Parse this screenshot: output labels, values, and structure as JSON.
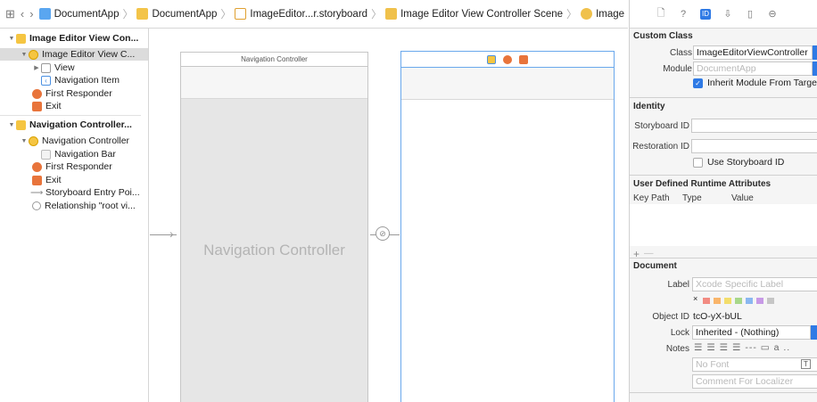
{
  "jumpbar": {
    "crumbs": [
      "DocumentApp",
      "DocumentApp",
      "ImageEditor...r.storyboard",
      "Image Editor View Controller Scene",
      "Image Editor View Controller"
    ]
  },
  "outline": {
    "rows": [
      {
        "label": "Image Editor View Con..."
      },
      {
        "label": "Image Editor View C..."
      },
      {
        "label": "View"
      },
      {
        "label": "Navigation Item"
      },
      {
        "label": "First Responder"
      },
      {
        "label": "Exit"
      },
      {
        "label": "Navigation Controller..."
      },
      {
        "label": "Navigation Controller"
      },
      {
        "label": "Navigation Bar"
      },
      {
        "label": "First Responder"
      },
      {
        "label": "Exit"
      },
      {
        "label": "Storyboard Entry Poi..."
      },
      {
        "label": "Relationship \"root vi..."
      }
    ]
  },
  "canvas": {
    "nav_scene_title": "Navigation Controller",
    "nav_body_label": "Navigation Controller"
  },
  "inspector": {
    "custom_class": {
      "title": "Custom Class",
      "class_label": "Class",
      "class_value": "ImageEditorViewController",
      "module_label": "Module",
      "module_placeholder": "DocumentApp",
      "inherit_label": "Inherit Module From Target",
      "inherit_checked": true
    },
    "identity": {
      "title": "Identity",
      "storyboard_id_label": "Storyboard ID",
      "storyboard_id_value": "",
      "restoration_id_label": "Restoration ID",
      "restoration_id_value": "",
      "use_storyboard_label": "Use Storyboard ID"
    },
    "runtime_attrs": {
      "title": "User Defined Runtime Attributes",
      "columns": [
        "Key Path",
        "Type",
        "Value"
      ],
      "add": "+",
      "remove": "—"
    },
    "document": {
      "title": "Document",
      "label_label": "Label",
      "label_placeholder": "Xcode Specific Label",
      "clear_label": "×",
      "label_colors": [
        "#f28b82",
        "#f9b56a",
        "#f3dd6b",
        "#a8d88a",
        "#8ab7f0",
        "#c79ae6",
        "#c6c6c6"
      ],
      "object_id_label": "Object ID",
      "object_id_value": "tcO-yX-bUL",
      "lock_label": "Lock",
      "lock_value": "Inherited - (Nothing)",
      "notes_label": "Notes",
      "font_placeholder": "No Font",
      "comment_placeholder": "Comment For Localizer"
    }
  }
}
